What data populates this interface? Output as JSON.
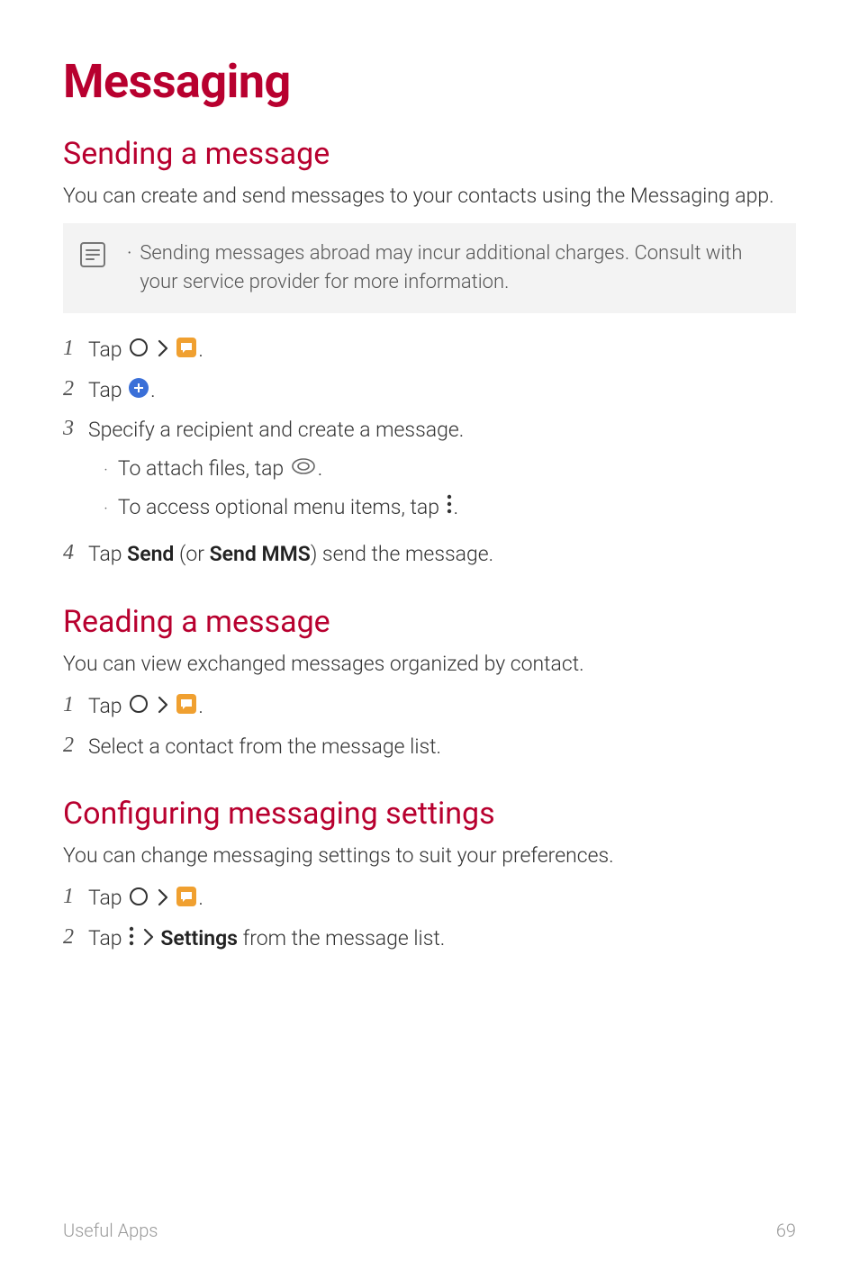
{
  "title": "Messaging",
  "sections": {
    "sending": {
      "heading": "Sending a message",
      "intro": "You can create and send messages to your contacts using the Messaging app.",
      "note": "Sending messages abroad may incur additional charges. Consult with your service provider for more information.",
      "step1_a": "Tap ",
      "step1_b": ".",
      "step2_a": "Tap ",
      "step2_b": ".",
      "step3": "Specify a recipient and create a message.",
      "step3_sub1_a": "To attach files, tap ",
      "step3_sub1_b": ".",
      "step3_sub2_a": "To access optional menu items, tap ",
      "step3_sub2_b": ".",
      "step4_a": "Tap ",
      "step4_send": "Send",
      "step4_b": " (or ",
      "step4_sendmms": "Send MMS",
      "step4_c": ") send the message."
    },
    "reading": {
      "heading": "Reading a message",
      "intro": "You can view exchanged messages organized by contact.",
      "step1_a": "Tap ",
      "step1_b": ".",
      "step2": "Select a contact from the message list."
    },
    "config": {
      "heading": "Configuring messaging settings",
      "intro": "You can change messaging settings to suit your preferences.",
      "step1_a": "Tap ",
      "step1_b": ".",
      "step2_a": "Tap ",
      "step2_gt": " ",
      "step2_settings": "Settings",
      "step2_b": " from the message list."
    }
  },
  "footer": {
    "left": "Useful Apps",
    "right": "69"
  }
}
